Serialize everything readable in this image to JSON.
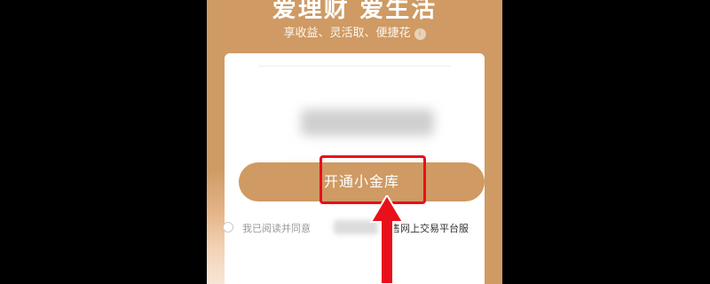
{
  "header": {
    "headline": "爱理财 爱生活",
    "subtitle": "享收益、灵活取、便捷花",
    "info_icon": "info-icon"
  },
  "card": {
    "open_button_label": "开通小金库"
  },
  "agreement": {
    "prefix": "我已阅读并同意",
    "link_text": "销售网上交易平台服"
  },
  "colors": {
    "brand": "#cf9a63",
    "highlight": "#e8101a",
    "background": "#000000"
  }
}
